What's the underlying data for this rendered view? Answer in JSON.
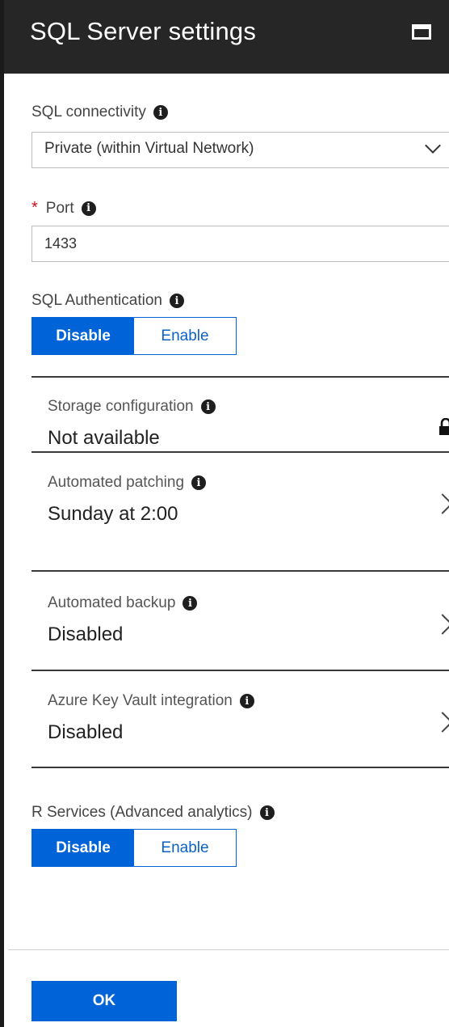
{
  "header": {
    "title": "SQL Server settings"
  },
  "connectivity": {
    "label": "SQL connectivity",
    "selected": "Private (within Virtual Network)"
  },
  "port": {
    "required_mark": "*",
    "label": "Port",
    "value": "1433"
  },
  "sql_auth": {
    "label": "SQL Authentication",
    "options": [
      "Disable",
      "Enable"
    ],
    "selected": "Disable"
  },
  "sections": [
    {
      "label": "Storage configuration",
      "value": "Not available",
      "icon": "lock-icon"
    },
    {
      "label": "Automated patching",
      "value": "Sunday at 2:00",
      "icon": "chevron-right-icon"
    },
    {
      "label": "Automated backup",
      "value": "Disabled",
      "icon": "chevron-right-icon"
    },
    {
      "label": "Azure Key Vault integration",
      "value": "Disabled",
      "icon": "chevron-right-icon"
    }
  ],
  "r_services": {
    "label": "R Services (Advanced analytics)",
    "options": [
      "Disable",
      "Enable"
    ],
    "selected": "Disable"
  },
  "footer": {
    "ok_label": "OK"
  },
  "colors": {
    "header_bg": "#262626",
    "accent": "#0063d8",
    "required": "#c50f1f"
  }
}
